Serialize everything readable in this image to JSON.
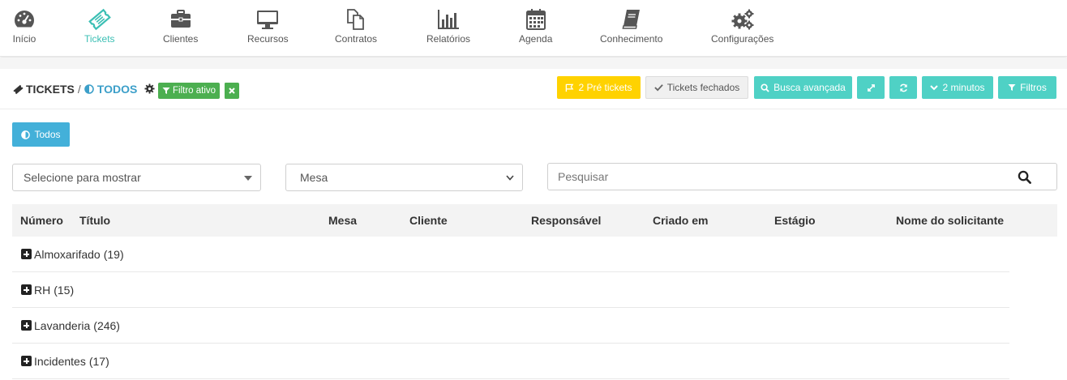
{
  "nav": {
    "items": [
      {
        "label": "Início",
        "icon": "dashboard-icon"
      },
      {
        "label": "Tickets",
        "icon": "ticket-icon",
        "active": true
      },
      {
        "label": "Clientes",
        "icon": "briefcase-icon"
      },
      {
        "label": "Recursos",
        "icon": "monitor-icon"
      },
      {
        "label": "Contratos",
        "icon": "documents-icon"
      },
      {
        "label": "Relatórios",
        "icon": "bar-chart-icon"
      },
      {
        "label": "Agenda",
        "icon": "calendar-icon"
      },
      {
        "label": "Conhecimento",
        "icon": "book-icon"
      },
      {
        "label": "Configurações",
        "icon": "gears-icon"
      }
    ],
    "active_color": "#3bbfb4"
  },
  "header": {
    "crumb_root": "TICKETS",
    "crumb_sep": "/",
    "crumb_current": "TODOS",
    "filter_badge": "Filtro ativo"
  },
  "toolbar": {
    "pre_tickets": "2 Pré tickets",
    "closed_tickets": "Tickets fechados",
    "advanced_search": "Busca avançada",
    "refresh_interval": "2 minutos",
    "filters": "Filtros"
  },
  "tabs": {
    "todos": "Todos"
  },
  "filters": {
    "show_select": "Selecione para mostrar",
    "desk_select": "Mesa",
    "search_placeholder": "Pesquisar"
  },
  "table": {
    "columns": [
      "Número",
      "Título",
      "Mesa",
      "Cliente",
      "Responsável",
      "Criado em",
      "Estágio",
      "Nome do solicitante"
    ],
    "groups": [
      {
        "name": "Almoxarifado",
        "count": "(19)"
      },
      {
        "name": "RH",
        "count": "(15)"
      },
      {
        "name": "Lavanderia",
        "count": "(246)"
      },
      {
        "name": "Incidentes",
        "count": "(17)"
      }
    ]
  },
  "colors": {
    "yellow": "#ffd200",
    "teal": "#4fd1c5",
    "blue": "#43b0d9",
    "green": "#4caf50"
  }
}
